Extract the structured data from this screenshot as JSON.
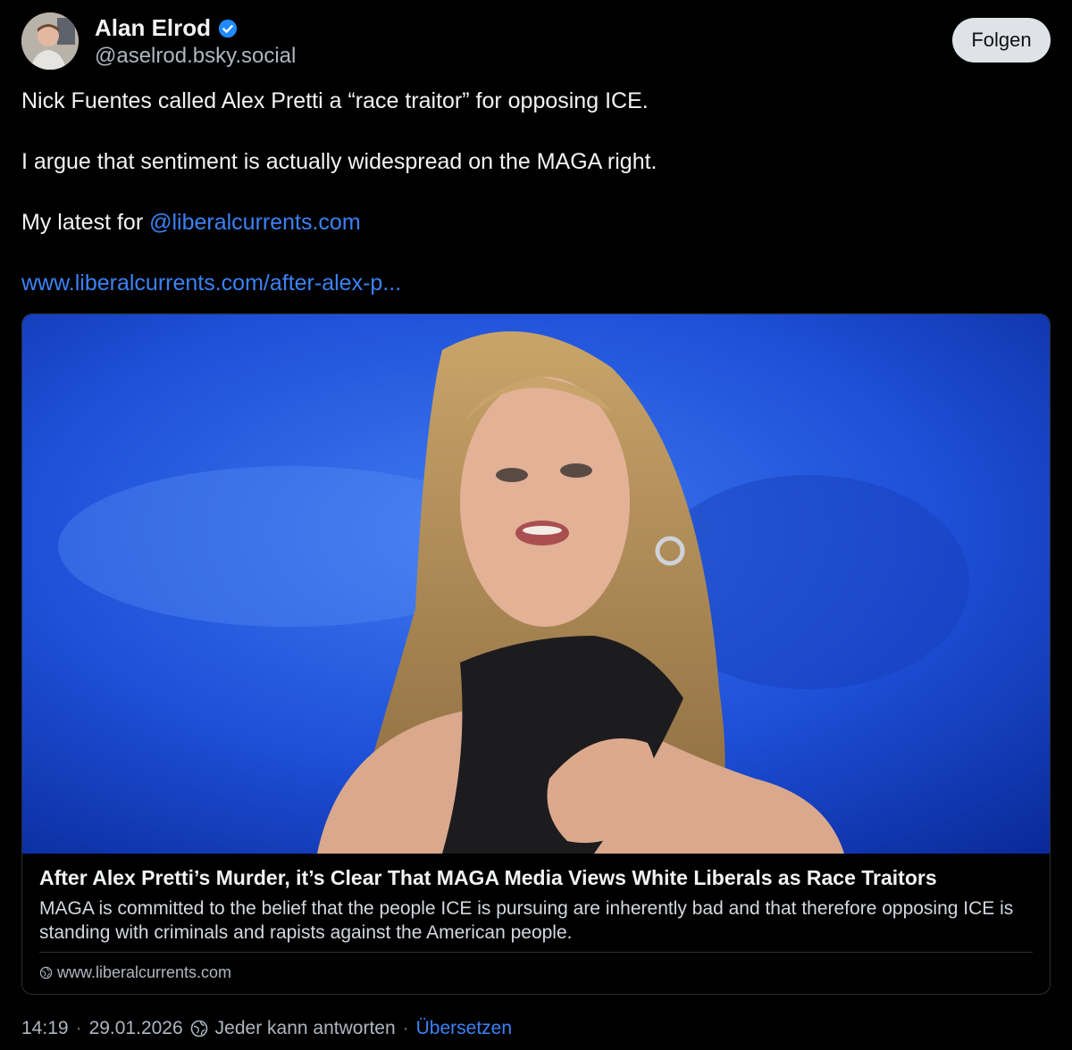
{
  "author": {
    "name": "Alan Elrod",
    "handle": "@aselrod.bsky.social",
    "verified_icon": "verified-badge-icon",
    "follow_label": "Folgen"
  },
  "post": {
    "line1": "Nick Fuentes called Alex Pretti a “race traitor” for opposing ICE.",
    "line2": "I argue that sentiment is actually widespread on the MAGA right.",
    "line3_prefix": "My latest for ",
    "mention": "@liberalcurrents.com",
    "url": "www.liberalcurrents.com/after-alex-p..."
  },
  "card": {
    "title": "After Alex Pretti’s Murder, it’s Clear That MAGA Media Views White Liberals as Race Traitors",
    "description": "MAGA is committed to the belief that the people ICE is pursuing are inherently bad and that therefore opposing ICE is standing with criminals and rapists against the American people.",
    "domain": "www.liberalcurrents.com"
  },
  "footer": {
    "time": "14:19",
    "dot1": "·",
    "date": "29.01.2026",
    "reply_setting": "Jeder kann antworten",
    "dot2": "·",
    "translate": "Übersetzen"
  },
  "colors": {
    "background": "#000000",
    "link": "#3b82f6",
    "verified": "#208bfe",
    "follow_bg": "#dfe3e8"
  }
}
